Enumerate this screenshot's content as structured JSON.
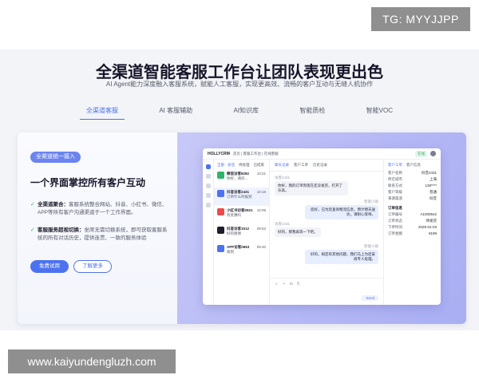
{
  "watermark_top": "TG: MYYJJPP",
  "watermark_bottom": "www.kaiyundengluzh.com",
  "hero": {
    "title": "全渠道智能客服工作台让团队表现更出色",
    "subtitle": "AI Agent能力深度融入客服系统，赋能人工客服，实现更高效、流畅的客户互动与无缝人机协作"
  },
  "tabs": [
    "全渠道客服",
    "AI 客服辅助",
    "AI知识库",
    "智能质检",
    "智能VOC"
  ],
  "card": {
    "badge": "全渠道统一接入",
    "title": "一个界面掌控所有客户互动",
    "features": [
      {
        "lead": "全渠道聚合：",
        "text": "客服系统整合网站、抖音、小红书、微信、APP等所有客户沟通渠道于一个工作界面。"
      },
      {
        "lead": "客服服务超视切换：",
        "text": "坐席无需切换系统，即可获取客服系统的所有对话历史，提供连贯、一致的服务体验"
      }
    ],
    "primary_button": "免费试用",
    "secondary_button": "了解更多"
  },
  "app": {
    "logo": "HOLLYCRM",
    "breadcrumb": "首页 | 客服工作台 | 在线客服",
    "status": "在线",
    "list_tabs": [
      "全部 · 会话",
      "待处理",
      "已结束"
    ],
    "conversations": [
      {
        "name": "微信访客8282",
        "preview": "你好，请问…",
        "time": "10:21",
        "color": "#2fb36b",
        "active": false
      },
      {
        "name": "抖音访客2431",
        "preview": "订单什么时候到",
        "time": "10:18",
        "color": "#4d72f0",
        "active": true
      },
      {
        "name": "小红书访客0921",
        "preview": "有优惠吗",
        "time": "10:05",
        "color": "#ec4b4b",
        "active": false
      },
      {
        "name": "抖音访客1512",
        "preview": "好的谢谢",
        "time": "09:52",
        "color": "#1d1d2b",
        "active": false
      },
      {
        "name": "APP访客0653",
        "preview": "收到",
        "time": "09:40",
        "color": "#4d72f0",
        "active": false
      }
    ],
    "chat_tabs": [
      "聊天记录",
      "客户工单",
      "历史记录"
    ],
    "messages": [
      {
        "meta": "访客2431",
        "text": "你好，我的订单到现在还没发货，打开了乐高。"
      },
      {
        "meta": "智能小助",
        "text": "您好，已为您查询物流信息，预计明天送达，请耐心等待。"
      },
      {
        "meta": "访客2431",
        "text": "好的，那我再等一下吧。"
      },
      {
        "meta": "智能小助",
        "text": "好的，如还有其他问题，我们马上为您安排专人处理。"
      }
    ],
    "composer_tools": "☺ ✂ ⊞ ⎘",
    "send_label": "Send",
    "side_tabs": [
      "客户工单",
      "客户信息"
    ],
    "side_rows": [
      {
        "k": "客户名称",
        "v": "抖音2431"
      },
      {
        "k": "所在城市",
        "v": "上海"
      },
      {
        "k": "联系方式",
        "v": "138****"
      },
      {
        "k": "客户等级",
        "v": "普通"
      },
      {
        "k": "来源渠道",
        "v": "抖音"
      }
    ],
    "side_head": "订单信息",
    "side_rows_2": [
      {
        "k": "订单编号",
        "v": "A1000542"
      },
      {
        "k": "订单状态",
        "v": "待发货"
      },
      {
        "k": "下单时间",
        "v": "2025-01-03"
      },
      {
        "k": "订单金额",
        "v": "¥199"
      }
    ]
  }
}
